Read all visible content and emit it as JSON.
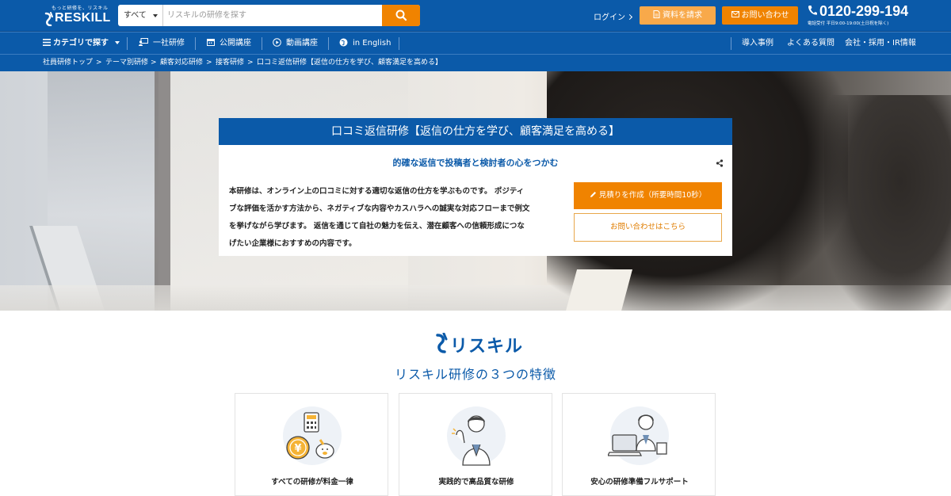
{
  "header": {
    "logo_tagline": "もっと研修を、リスキル",
    "logo_text": "RESKILL",
    "search": {
      "category": "すべて",
      "placeholder": "リスキルの研修を探す"
    },
    "login_label": "ログイン",
    "doc_button": "資料を請求",
    "contact_button": "お問い合わせ",
    "phone": "0120-299-194",
    "phone_hours": "電話受付 平日9:00-19:00(土日祝を除く)"
  },
  "nav": {
    "category_label": "カテゴリで探す",
    "items": [
      {
        "label": "一社研修",
        "icon": "training-icon"
      },
      {
        "label": "公開講座",
        "icon": "calendar-icon"
      },
      {
        "label": "動画講座",
        "icon": "play-icon"
      },
      {
        "label": "in English",
        "icon": "globe-icon"
      }
    ],
    "right_links": [
      "導入事例",
      "よくある質問",
      "会社・採用・IR情報"
    ]
  },
  "breadcrumb": [
    "社員研修トップ",
    "テーマ別研修",
    "顧客対応研修",
    "接客研修",
    "口コミ返信研修【返信の仕方を学び、顧客満足を高める】"
  ],
  "breadcrumb_separator": ">",
  "hero_card": {
    "title": "口コミ返信研修【返信の仕方を学び、顧客満足を高める】",
    "subtitle": "的確な返信で投稿者と検討者の心をつかむ",
    "body_lines": [
      "本研修は、オンライン上の口コミに対する適切な返信の仕方を学ぶものです。 ポジティ",
      "ブな評価を活かす方法から、ネガティブな内容やカスハラへの誠実な対応フローまで例文",
      "を挙げながら学びます。 返信を通じて自社の魅力を伝え、潜在顧客への信頼形成につな",
      "げたい企業様におすすめの内容です。"
    ],
    "quote_button": "見積りを作成（所要時間10秒）",
    "inquiry_button": "お問い合わせはこちら"
  },
  "brand_name": "リスキル",
  "features_title": "リスキル研修の３つの特徴",
  "features": [
    {
      "label": "すべての研修が料金一律",
      "icon": "calculator-coin-icon"
    },
    {
      "label": "実践的で高品質な研修",
      "icon": "instructor-icon"
    },
    {
      "label": "安心の研修準備フルサポート",
      "icon": "support-operator-icon"
    }
  ],
  "colors": {
    "brand_blue": "#0b5aa9",
    "accent_orange": "#f08300",
    "light_orange": "#f8a94a"
  }
}
